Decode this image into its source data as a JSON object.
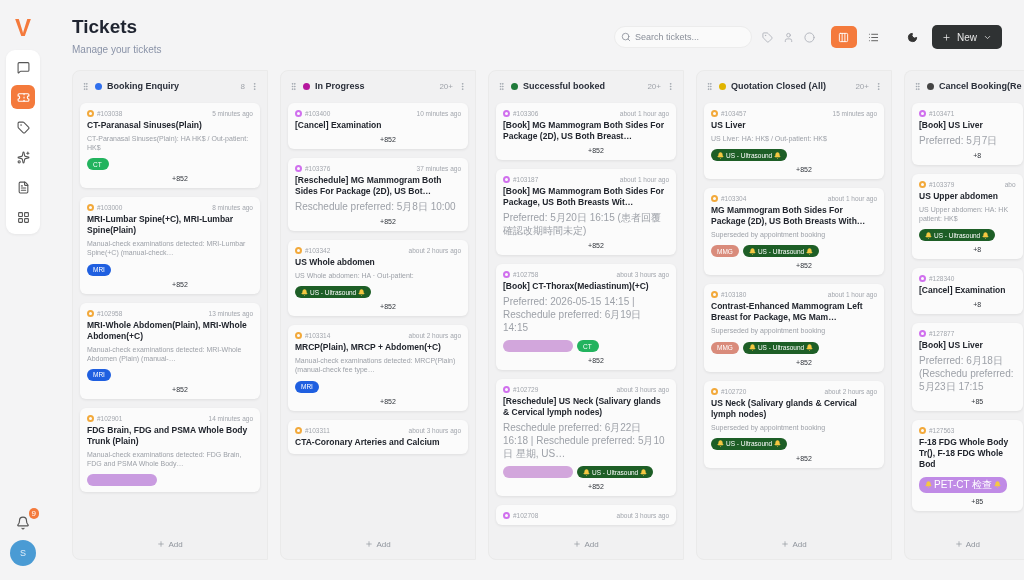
{
  "logo": "V",
  "nav": [
    {
      "selected": false
    },
    {
      "selected": true
    },
    {
      "selected": false
    },
    {
      "selected": false
    },
    {
      "selected": false
    },
    {
      "selected": false
    }
  ],
  "notifications": {
    "badge": "9"
  },
  "avatar": "S",
  "header": {
    "title": "Tickets",
    "subtitle": "Manage your tickets"
  },
  "search": {
    "placeholder": "Search tickets..."
  },
  "views": [
    {
      "selected": true
    },
    {
      "selected": false
    }
  ],
  "new_button": "New",
  "columns": [
    {
      "title": "Booking Enquiry",
      "color": "#2f6fed",
      "count": "8",
      "add": "Add",
      "cards": [
        {
          "id": "#103038",
          "time": "5 minutes ago",
          "color": "#f2a93b",
          "title": "CT-Paranasal Sinuses(Plain)",
          "description": "CT-Paranasal Sinuses(Plain): HA HK$ / Out-patient: HK$",
          "tags": [
            {
              "label": "CT",
              "color": "#22b35e"
            }
          ],
          "phone": "+852"
        },
        {
          "id": "#103000",
          "time": "8 minutes ago",
          "color": "#f2a93b",
          "title": "MRI-Lumbar Spine(+C), MRI-Lumbar Spine(Plain)",
          "description": "Manual-check examinations detected: MRI-Lumbar Spine(+C) (manual-check…",
          "tags": [
            {
              "label": "MRI",
              "color": "#1f5fe0"
            }
          ],
          "phone": "+852"
        },
        {
          "id": "#102958",
          "time": "13 minutes ago",
          "color": "#f2a93b",
          "title": "MRI-Whole Abdomen(Plain), MRI-Whole Abdomen(+C)",
          "description": "Manual-check examinations detected: MRI-Whole Abdomen (Plain) (manual-…",
          "tags": [
            {
              "label": "MRI",
              "color": "#1f5fe0"
            }
          ],
          "phone": "+852"
        },
        {
          "id": "#102901",
          "time": "14 minutes ago",
          "color": "#f2a93b",
          "title": "FDG Brain, FDG and PSMA Whole Body Trunk (Plain)",
          "description": "Manual-check examinations detected: FDG Brain, FDG and PSMA Whole Body…",
          "tags": [
            {
              "color": "#c99be0"
            }
          ]
        }
      ]
    },
    {
      "title": "In Progress",
      "color": "#b5179e",
      "count": "20+",
      "add": "Add",
      "cards": [
        {
          "id": "#103400",
          "time": "10 minutes ago",
          "color": "#d070ee",
          "title": "[Cancel] Examination",
          "phone": "+852"
        },
        {
          "id": "#103376",
          "time": "37 minutes ago",
          "color": "#d070ee",
          "title": "[Reschedule] MG Mammogram Both Sides For Package (2D), US Bot…",
          "description": "Reschedule preferred: 5月8日 10:00",
          "cjk": true,
          "phone": "+852"
        },
        {
          "id": "#103342",
          "time": "about 2 hours ago",
          "color": "#f2a93b",
          "title": "US Whole abdomen",
          "description": "US Whole abdomen: HA · Out-patient:",
          "tags": [
            {
              "label": "US - Ultrasound",
              "color": "#1d5e26",
              "alert": true
            }
          ],
          "phone": "+852"
        },
        {
          "id": "#103314",
          "time": "about 2 hours ago",
          "color": "#f2a93b",
          "title": "MRCP(Plain), MRCP + Abdomen(+C)",
          "description": "Manual-check examinations detected: MRCP(Plain) (manual-check fee type…",
          "tags": [
            {
              "label": "MRI",
              "color": "#1f5fe0"
            }
          ],
          "phone": "+852"
        },
        {
          "id": "#103311",
          "time": "about 3 hours ago",
          "color": "#f2a93b",
          "title": "CTA-Coronary Arteries and Calcium"
        }
      ]
    },
    {
      "title": "Successful booked",
      "color": "#1f7a3a",
      "count": "20+",
      "add": "Add",
      "cards": [
        {
          "id": "#103306",
          "time": "about 1 hour ago",
          "color": "#d070ee",
          "title": "[Book] MG Mammogram Both Sides For Package (2D), US Both Breast…",
          "phone": "+852"
        },
        {
          "id": "#103187",
          "time": "about 1 hour ago",
          "color": "#d070ee",
          "title": "[Book] MG Mammogram Both Sides For Package, US Both Breasts Wit…",
          "description": "Preferred: 5月20日 16:15 (患者回覆確認改期時間未定)",
          "cjk": true,
          "phone": "+852"
        },
        {
          "id": "#102758",
          "time": "about 3 hours ago",
          "color": "#d070ee",
          "title": "[Book] CT-Thorax(Mediastinum)(+C)",
          "description": "Preferred: 2026-05-15 14:15 | Reschedule preferred: 6月19日 14:15",
          "cjk": true,
          "tags": [
            {
              "color": "#d2a6dc"
            },
            {
              "label": "CT",
              "color": "#22b35e"
            }
          ],
          "phone": "+852"
        },
        {
          "id": "#102729",
          "time": "about 3 hours ago",
          "color": "#d070ee",
          "title": "[Reschedule] US Neck (Salivary glands & Cervical lymph nodes)",
          "description": "Reschedule preferred: 6月22日 16:18 | Reschedule preferred: 5月10日 星期, US…",
          "cjk": true,
          "tags": [
            {
              "color": "#d2a6dc"
            },
            {
              "label": "US - Ultrasound",
              "color": "#1d5e26",
              "alert": true
            }
          ],
          "phone": "+852"
        },
        {
          "id": "#102708",
          "time": "about 3 hours ago",
          "color": "#d070ee"
        }
      ]
    },
    {
      "title": "Quotation Closed (All)",
      "color": "#e0b400",
      "count": "20+",
      "add": "Add",
      "cards": [
        {
          "id": "#103457",
          "time": "15 minutes ago",
          "color": "#f2a93b",
          "title": "US Liver",
          "description": "US Liver: HA: HK$ / Out-patient: HK$",
          "tags": [
            {
              "label": "US - Ultrasound",
              "color": "#1d5e26",
              "alert": true
            }
          ],
          "phone": "+852"
        },
        {
          "id": "#103304",
          "time": "about 1 hour ago",
          "color": "#f2a93b",
          "title": "MG Mammogram Both Sides For Package (2D), US Both Breasts With…",
          "description": "Superseded by appointment booking",
          "tags": [
            {
              "label": "MMG",
              "color": "#d98b7b"
            },
            {
              "label": "US - Ultrasound",
              "color": "#1d5e26",
              "alert": true
            }
          ],
          "phone": "+852"
        },
        {
          "id": "#103180",
          "time": "about 1 hour ago",
          "color": "#f2a93b",
          "title": "Contrast-Enhanced Mammogram Left Breast for Package, MG Mam…",
          "description": "Superseded by appointment booking",
          "tags": [
            {
              "label": "MMG",
              "color": "#d98b7b"
            },
            {
              "label": "US - Ultrasound",
              "color": "#1d5e26",
              "alert": true
            }
          ],
          "phone": "+852"
        },
        {
          "id": "#102720",
          "time": "about 2 hours ago",
          "color": "#f2a93b",
          "title": "US Neck (Salivary glands & Cervical lymph nodes)",
          "description": "Superseded by appointment booking",
          "tags": [
            {
              "label": "US - Ultrasound",
              "color": "#1d5e26",
              "alert": true
            }
          ],
          "phone": "+852"
        }
      ]
    },
    {
      "title": "Cancel Booking(Re",
      "color": "#444444",
      "add": "Add",
      "cards": [
        {
          "id": "#103471",
          "color": "#d070ee",
          "title": "[Book] US Liver",
          "description": "Preferred: 5月7日",
          "cjk": true,
          "phone": "+8"
        },
        {
          "id": "#103379",
          "time": "abo",
          "color": "#f2a93b",
          "title": "US Upper abdomen",
          "description": "US Upper abdomen: HA: HK patient: HK$",
          "tags": [
            {
              "label": "US - Ultrasound",
              "color": "#1d5e26",
              "alert": true
            }
          ],
          "phone": "+8"
        },
        {
          "id": "#128340",
          "color": "#d070ee",
          "title": "[Cancel] Examination",
          "phone": "+8"
        },
        {
          "id": "#127877",
          "color": "#d070ee",
          "title": "[Book] US Liver",
          "description": "Preferred: 6月18日 (Reschedu preferred: 5月23日 17:15",
          "cjk": true,
          "phone": "+85"
        },
        {
          "id": "#127563",
          "color": "#f2a93b",
          "title": "F-18 FDG Whole Body Tr(), F-18 FDG Whole Bod",
          "tags": [
            {
              "label": "PET-CT 检查",
              "color": "#c08be6",
              "alert": true,
              "cjk": true
            }
          ],
          "phone": "+85"
        }
      ]
    }
  ]
}
